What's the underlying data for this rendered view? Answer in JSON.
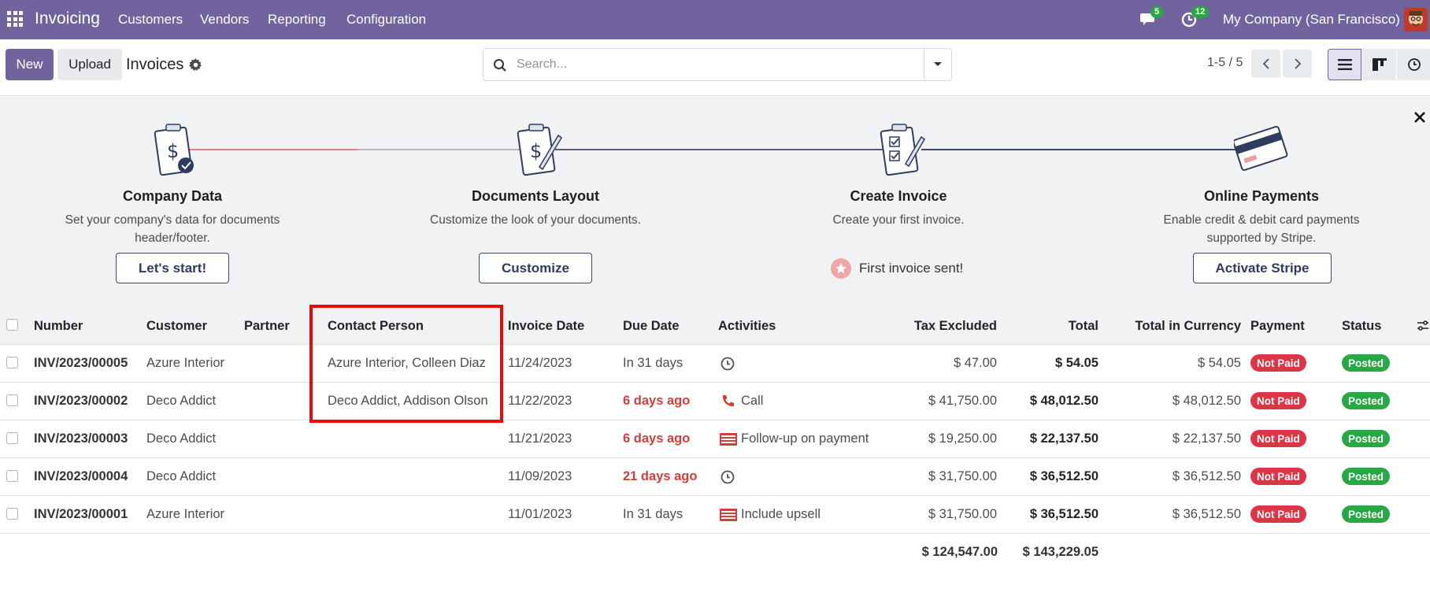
{
  "navbar": {
    "app_name": "Invoicing",
    "menu": [
      "Customers",
      "Vendors",
      "Reporting",
      "Configuration"
    ],
    "messages_count": "5",
    "activities_count": "12",
    "company": "My Company (San Francisco)"
  },
  "control": {
    "new_label": "New",
    "upload_label": "Upload",
    "title": "Invoices",
    "search_placeholder": "Search...",
    "pager": "1-5 / 5"
  },
  "onboarding": {
    "steps": [
      {
        "title": "Company Data",
        "desc": "Set your company's data for documents header/footer.",
        "button": "Let's start!"
      },
      {
        "title": "Documents Layout",
        "desc": "Customize the look of your documents.",
        "button": "Customize"
      },
      {
        "title": "Create Invoice",
        "desc": "Create your first invoice.",
        "done": "First invoice sent!"
      },
      {
        "title": "Online Payments",
        "desc": "Enable credit & debit card payments supported by Stripe.",
        "button": "Activate Stripe"
      }
    ]
  },
  "table": {
    "headers": [
      "Number",
      "Customer",
      "Partner",
      "Contact Person",
      "Invoice Date",
      "Due Date",
      "Activities",
      "Tax Excluded",
      "Total",
      "Total in Currency",
      "Payment",
      "Status"
    ],
    "rows": [
      {
        "number": "INV/2023/00005",
        "customer": "Azure Interior",
        "partner": "",
        "contact": "Azure Interior, Colleen Diaz",
        "invoice_date": "11/24/2023",
        "due_date": "In 31 days",
        "due_overdue": false,
        "activity_icon": "clock-icon",
        "activity": "",
        "tax_excluded": "$ 47.00",
        "total": "$ 54.05",
        "total_currency": "$ 54.05",
        "payment": "Not Paid",
        "status": "Posted"
      },
      {
        "number": "INV/2023/00002",
        "customer": "Deco Addict",
        "partner": "",
        "contact": "Deco Addict, Addison Olson",
        "invoice_date": "11/22/2023",
        "due_date": "6 days ago",
        "due_overdue": true,
        "activity_icon": "phone-icon",
        "activity": "Call",
        "tax_excluded": "$ 41,750.00",
        "total": "$ 48,012.50",
        "total_currency": "$ 48,012.50",
        "payment": "Not Paid",
        "status": "Posted"
      },
      {
        "number": "INV/2023/00003",
        "customer": "Deco Addict",
        "partner": "",
        "contact": "",
        "invoice_date": "11/21/2023",
        "due_date": "6 days ago",
        "due_overdue": true,
        "activity_icon": "task-list-icon",
        "activity": "Follow-up on payment",
        "tax_excluded": "$ 19,250.00",
        "total": "$ 22,137.50",
        "total_currency": "$ 22,137.50",
        "payment": "Not Paid",
        "status": "Posted"
      },
      {
        "number": "INV/2023/00004",
        "customer": "Deco Addict",
        "partner": "",
        "contact": "",
        "invoice_date": "11/09/2023",
        "due_date": "21 days ago",
        "due_overdue": true,
        "activity_icon": "clock-icon",
        "activity": "",
        "tax_excluded": "$ 31,750.00",
        "total": "$ 36,512.50",
        "total_currency": "$ 36,512.50",
        "payment": "Not Paid",
        "status": "Posted"
      },
      {
        "number": "INV/2023/00001",
        "customer": "Azure Interior",
        "partner": "",
        "contact": "",
        "invoice_date": "11/01/2023",
        "due_date": "In 31 days",
        "due_overdue": false,
        "activity_icon": "task-list-icon",
        "activity": "Include upsell",
        "tax_excluded": "$ 31,750.00",
        "total": "$ 36,512.50",
        "total_currency": "$ 36,512.50",
        "payment": "Not Paid",
        "status": "Posted"
      }
    ],
    "totals": {
      "tax_excluded": "$ 124,547.00",
      "total": "$ 143,229.05"
    }
  },
  "colors": {
    "brand": "#71639e",
    "danger": "#dc3545",
    "success": "#28a745",
    "highlight": "#e8090f"
  }
}
